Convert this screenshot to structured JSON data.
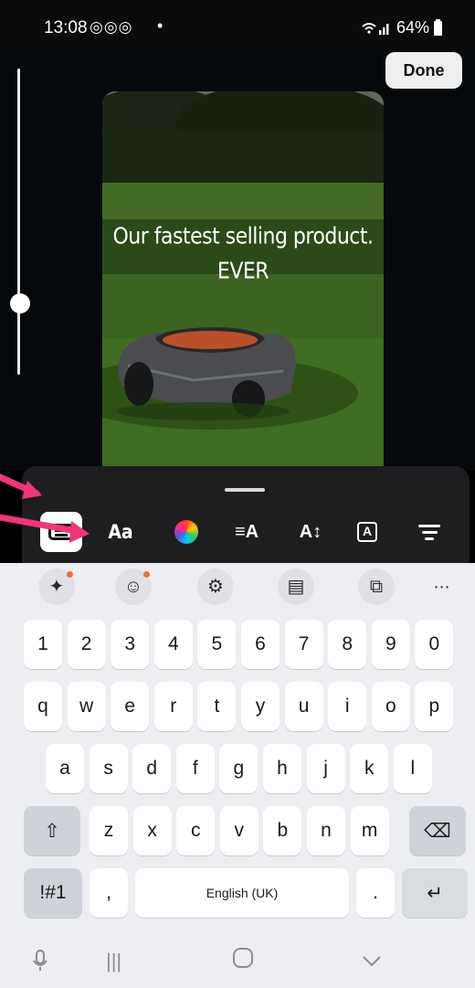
{
  "status_bar": {
    "time": "13:08",
    "notification_icons": "ⒾⒾⒾ",
    "dot": "•",
    "signal": "📶",
    "battery": "64%"
  },
  "editor": {
    "done_label": "Done",
    "caption_line1": "Our fastest selling product.",
    "caption_line2": "EVER"
  },
  "text_tools": {
    "font_label": "Aa",
    "align_label": "≡A",
    "size_label": "A↕",
    "background_label": "A",
    "icons": [
      "keyboard-icon",
      "font-icon",
      "color-wheel-icon",
      "align-icon",
      "text-size-icon",
      "text-background-icon",
      "animate-icon"
    ]
  },
  "keyboard": {
    "suggestions": [
      "✦",
      "☺",
      "⚙",
      "▤",
      "⧉",
      "⋯"
    ],
    "number_row": [
      "1",
      "2",
      "3",
      "4",
      "5",
      "6",
      "7",
      "8",
      "9",
      "0"
    ],
    "row1": [
      "q",
      "w",
      "e",
      "r",
      "t",
      "y",
      "u",
      "i",
      "o",
      "p"
    ],
    "row2": [
      "a",
      "s",
      "d",
      "f",
      "g",
      "h",
      "j",
      "k",
      "l"
    ],
    "row3": [
      "z",
      "x",
      "c",
      "v",
      "b",
      "n",
      "m"
    ],
    "shift": "⇧",
    "backspace": "⌫",
    "symbols": "!#1",
    "comma": ",",
    "space": "English (UK)",
    "period": ".",
    "enter": "↵"
  },
  "nav": {
    "mic": "🎙",
    "recents": "|||",
    "home": "◯",
    "back": "∨"
  },
  "colors": {
    "accent_arrow": "#f0357a",
    "panel_bg": "#1e1e20",
    "keyboard_bg": "#eceef2"
  }
}
